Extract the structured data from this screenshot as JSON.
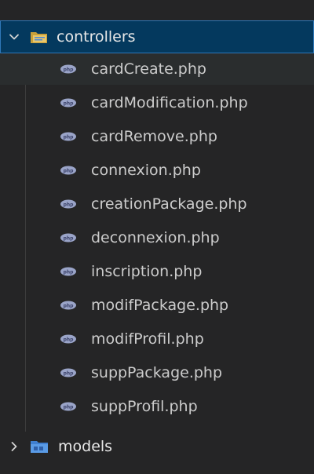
{
  "explorer": {
    "open_folder": {
      "label": "controllers",
      "icon": "folder-open-icon",
      "chevron": "chevron-down-icon"
    },
    "files": [
      {
        "label": "cardCreate.php",
        "icon": "php-file-icon"
      },
      {
        "label": "cardModification.php",
        "icon": "php-file-icon"
      },
      {
        "label": "cardRemove.php",
        "icon": "php-file-icon"
      },
      {
        "label": "connexion.php",
        "icon": "php-file-icon"
      },
      {
        "label": "creationPackage.php",
        "icon": "php-file-icon"
      },
      {
        "label": "deconnexion.php",
        "icon": "php-file-icon"
      },
      {
        "label": "inscription.php",
        "icon": "php-file-icon"
      },
      {
        "label": "modifPackage.php",
        "icon": "php-file-icon"
      },
      {
        "label": "modifProfil.php",
        "icon": "php-file-icon"
      },
      {
        "label": "suppPackage.php",
        "icon": "php-file-icon"
      },
      {
        "label": "suppProfil.php",
        "icon": "php-file-icon"
      }
    ],
    "closed_folder": {
      "label": "models",
      "icon": "folder-closed-icon",
      "chevron": "chevron-right-icon"
    },
    "colors": {
      "background": "#252526",
      "selected_background": "#04395e",
      "selected_border": "#2f77b8",
      "hover_background": "#2a2d2e",
      "text": "#cccccc",
      "php_icon": "#9aa4c8"
    }
  }
}
